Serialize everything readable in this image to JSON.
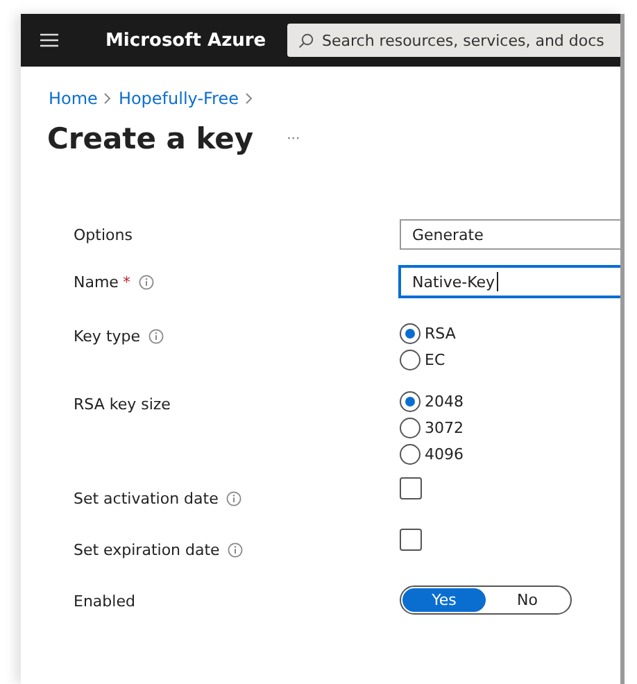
{
  "header": {
    "brand": "Microsoft Azure",
    "search": {
      "placeholder": "Search resources, services, and docs"
    }
  },
  "breadcrumb": [
    "Home",
    "Hopefully-Free"
  ],
  "title": "Create a key",
  "more": "···",
  "fields": [
    {
      "kind": "dropdown",
      "label": "Options",
      "value": "Generate"
    },
    {
      "kind": "text",
      "label": "Name",
      "required_mark": "*",
      "info": true,
      "value": "Native-Key"
    },
    {
      "kind": "radio",
      "label": "Key type",
      "info": true,
      "options": [
        {
          "label": "RSA",
          "selected": true
        },
        {
          "label": "EC",
          "selected": false
        }
      ]
    },
    {
      "kind": "radio",
      "label": "RSA key size",
      "info": false,
      "options": [
        {
          "label": "2048",
          "selected": true
        },
        {
          "label": "3072",
          "selected": false
        },
        {
          "label": "4096",
          "selected": false
        }
      ]
    },
    {
      "kind": "checkbox",
      "label": "Set activation date",
      "info": true,
      "checked": false
    },
    {
      "kind": "checkbox",
      "label": "Set expiration date",
      "info": true,
      "checked": false
    },
    {
      "kind": "toggle",
      "label": "Enabled",
      "options": [
        {
          "label": "Yes",
          "selected": true
        },
        {
          "label": "No",
          "selected": false
        }
      ]
    }
  ]
}
